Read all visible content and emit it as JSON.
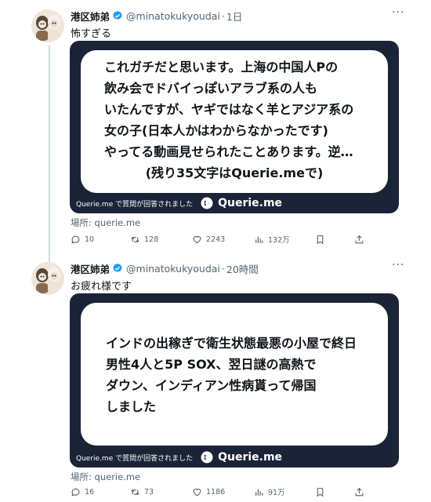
{
  "colors": {
    "accent": "#1d9bf0",
    "media_bg": "#1b2337",
    "muted": "#536471"
  },
  "tweets": [
    {
      "author_name": "港区姉弟",
      "handle": "@minatokukyoudai",
      "separator": "·",
      "time": "1日",
      "text": "怖すぎる",
      "bubble_text": "これガチだと思います。上海の中国人Pの\n飲み会でドバイっぽいアラブ系の人も\nいたんですが、ヤギではなく羊とアジア系の\n女の子(日本人かはわからなかったです)\nやってる動画見せられたことあります。逆…",
      "bubble_note": "(残り35文字はQuerie.meで)",
      "media_caption": "Querie.me で質問が回答されました",
      "media_brand": "Querie.me",
      "location": "場所: querie.me",
      "stats": {
        "replies": "10",
        "retweets": "128",
        "likes": "2243",
        "views": "132万"
      }
    },
    {
      "author_name": "港区姉弟",
      "handle": "@minatokukyoudai",
      "separator": "·",
      "time": "20時間",
      "text": "お疲れ様です",
      "bubble_text": "インドの出稼ぎで衛生状態最悪の小屋で終日\n男性4人と5P SOX、翌日謎の高熱で\nダウン、インディアン性病貰って帰国\nしました",
      "media_caption": "Querie.me で質問が回答されました",
      "media_brand": "Querie.me",
      "location": "場所: querie.me",
      "stats": {
        "replies": "16",
        "retweets": "73",
        "likes": "1186",
        "views": "91万"
      }
    }
  ]
}
